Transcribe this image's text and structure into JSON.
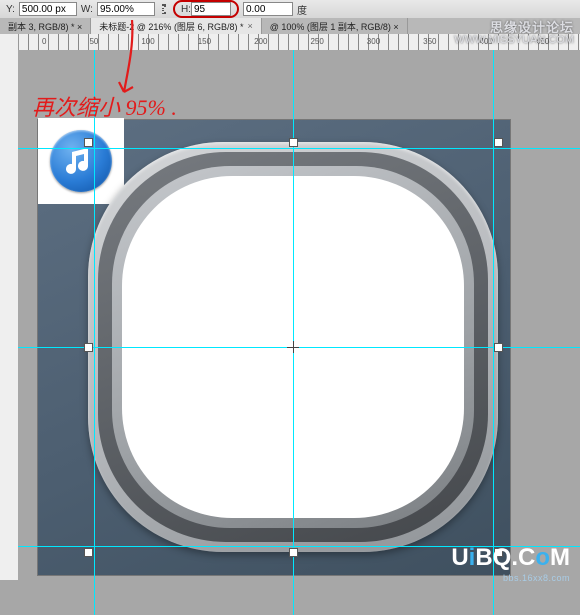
{
  "options": {
    "y_label": "Y:",
    "y_value": "500.00 px",
    "w_label": "W:",
    "w_value": "95.00%",
    "h_label": "H:",
    "h_value": "95",
    "angle_label": "度",
    "angle_value": "0.00"
  },
  "tabs": [
    {
      "label": "副本 3, RGB/8) * ×",
      "active": false
    },
    {
      "label": "未标题-2 @ 216% (图层 6, RGB/8) *",
      "active": true
    },
    {
      "label": "@ 100% (图层 1 副本, RGB/8) ×",
      "active": false
    }
  ],
  "ruler_h": [
    "0",
    "50",
    "100",
    "150",
    "200",
    "250",
    "300",
    "350",
    "400",
    "450"
  ],
  "annotation": {
    "text": "再次缩小 95% ."
  },
  "watermark_top": {
    "main": "思缘设计论坛",
    "sub": "WWW.MISSYUAN.COM"
  },
  "watermark_bottom": {
    "text_parts": [
      "U",
      "i",
      "BQ.C",
      "o",
      "M"
    ],
    "sub": "bbs.16xx8.com"
  },
  "icons": {
    "link": "⟡",
    "music": "♫"
  }
}
